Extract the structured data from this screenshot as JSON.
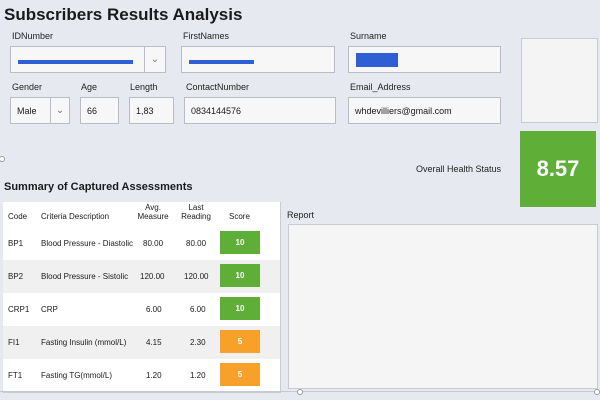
{
  "page": {
    "title": "Subscribers Results Analysis"
  },
  "form": {
    "id_number": {
      "label": "IDNumber",
      "value": ""
    },
    "first_names": {
      "label": "FirstNames",
      "value": ""
    },
    "surname": {
      "label": "Surname",
      "value": ""
    },
    "gender": {
      "label": "Gender",
      "value": "Male"
    },
    "age": {
      "label": "Age",
      "value": "66"
    },
    "length": {
      "label": "Length",
      "value": "1,83"
    },
    "contact": {
      "label": "ContactNumber",
      "value": "0834144576"
    },
    "email": {
      "label": "Email_Address",
      "value": "whdevilliers@gmail.com"
    }
  },
  "health": {
    "label": "Overall Health Status",
    "value": "8.57",
    "color": "#5fae38"
  },
  "assessments": {
    "title": "Summary of Captured Assessments",
    "columns": {
      "code": "Code",
      "criteria": "Criteria Description",
      "avg_measure": "Avg. Measure",
      "last_reading": "Last Reading",
      "score": "Score"
    },
    "rows": [
      {
        "code": "BP1",
        "criteria": "Blood Pressure - Diastolic",
        "avg": "80.00",
        "last": "80.00",
        "score": "10",
        "score_color": "#5fae38"
      },
      {
        "code": "BP2",
        "criteria": "Blood Pressure - Sistolic",
        "avg": "120.00",
        "last": "120.00",
        "score": "10",
        "score_color": "#5fae38"
      },
      {
        "code": "CRP1",
        "criteria": "CRP",
        "avg": "6.00",
        "last": "6.00",
        "score": "10",
        "score_color": "#5fae38"
      },
      {
        "code": "FI1",
        "criteria": "Fasting Insulin (mmol/L)",
        "avg": "4.15",
        "last": "2.30",
        "score": "5",
        "score_color": "#f7a12b"
      },
      {
        "code": "FT1",
        "criteria": "Fasting TG(mmol/L)",
        "avg": "1.20",
        "last": "1.20",
        "score": "5",
        "score_color": "#f7a12b"
      }
    ]
  },
  "report": {
    "label": "Report"
  }
}
